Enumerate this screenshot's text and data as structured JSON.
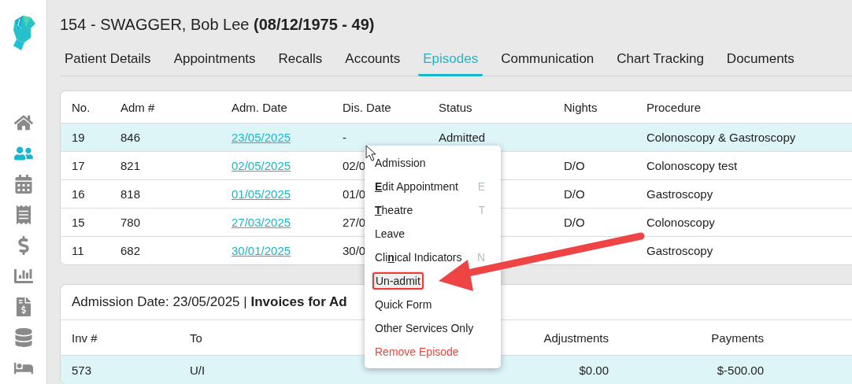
{
  "nav": [
    {
      "selected": false
    },
    {
      "selected": true
    },
    {
      "selected": false
    },
    {
      "selected": false
    },
    {
      "selected": false
    },
    {
      "selected": false
    },
    {
      "selected": false
    },
    {
      "selected": false
    },
    {
      "selected": false
    }
  ],
  "patient": {
    "name": "154 - SWAGGER, Bob Lee",
    "dob": "(08/12/1975 - 49)"
  },
  "tabs": [
    {
      "label": "Patient Details",
      "selected": false
    },
    {
      "label": "Appointments",
      "selected": false
    },
    {
      "label": "Recalls",
      "selected": false
    },
    {
      "label": "Accounts",
      "selected": false
    },
    {
      "label": "Episodes",
      "selected": true
    },
    {
      "label": "Communication",
      "selected": false
    },
    {
      "label": "Chart Tracking",
      "selected": false
    },
    {
      "label": "Documents",
      "selected": false
    }
  ],
  "episodes": {
    "columns": [
      "No.",
      "Adm #",
      "Adm. Date",
      "Dis. Date",
      "Status",
      "Nights",
      "Procedure"
    ],
    "rows": [
      {
        "no": "19",
        "adm": "846",
        "adm_date": "23/05/2025",
        "dis_date": "-",
        "status": "Admitted",
        "nights": "",
        "procedure": "Colonoscopy & Gastroscopy",
        "selected": true
      },
      {
        "no": "17",
        "adm": "821",
        "adm_date": "02/05/2025",
        "dis_date": "02/0",
        "status": "",
        "nights": "D/O",
        "procedure": "Colonoscopy test",
        "selected": false
      },
      {
        "no": "16",
        "adm": "818",
        "adm_date": "01/05/2025",
        "dis_date": "01/0",
        "status": "",
        "nights": "D/O",
        "procedure": "Gastroscopy",
        "selected": false
      },
      {
        "no": "15",
        "adm": "780",
        "adm_date": "27/03/2025",
        "dis_date": "27/0",
        "status": "",
        "nights": "D/O",
        "procedure": "Colonoscopy",
        "selected": false
      },
      {
        "no": "11",
        "adm": "682",
        "adm_date": "30/01/2025",
        "dis_date": "30/0",
        "status": "",
        "nights": "",
        "procedure": "Gastroscopy",
        "selected": false
      }
    ]
  },
  "invoices": {
    "title": "Admission Date: 23/05/2025 | **Invoices for Ad**",
    "columns": [
      "Inv #",
      "To",
      "Adjustments",
      "Payments"
    ],
    "rows": [
      {
        "inv": "573",
        "to": "U/I",
        "adjustments": "$0.00",
        "payments": "$-500.00",
        "selected": true
      }
    ]
  },
  "context_menu": {
    "items": [
      {
        "label": "Admission",
        "kind": "normal",
        "highlighted": false
      },
      {
        "label": "**E**dit Appointment",
        "shortcut": "E",
        "kind": "normal",
        "highlighted": false
      },
      {
        "label": "**T**heatre",
        "shortcut": "T",
        "kind": "normal",
        "highlighted": false
      },
      {
        "label": "Leave",
        "kind": "normal",
        "highlighted": false
      },
      {
        "label": "Cli**n**ical Indicators",
        "shortcut": "N",
        "kind": "normal",
        "highlighted": false
      },
      {
        "label": "Un-admit",
        "kind": "normal",
        "highlighted": true
      },
      {
        "label": "Quick Form",
        "kind": "normal",
        "highlighted": false
      },
      {
        "label": "Other Services Only",
        "kind": "normal",
        "highlighted": false
      },
      {
        "label": "Remove Episode",
        "kind": "danger",
        "highlighted": false
      }
    ]
  }
}
